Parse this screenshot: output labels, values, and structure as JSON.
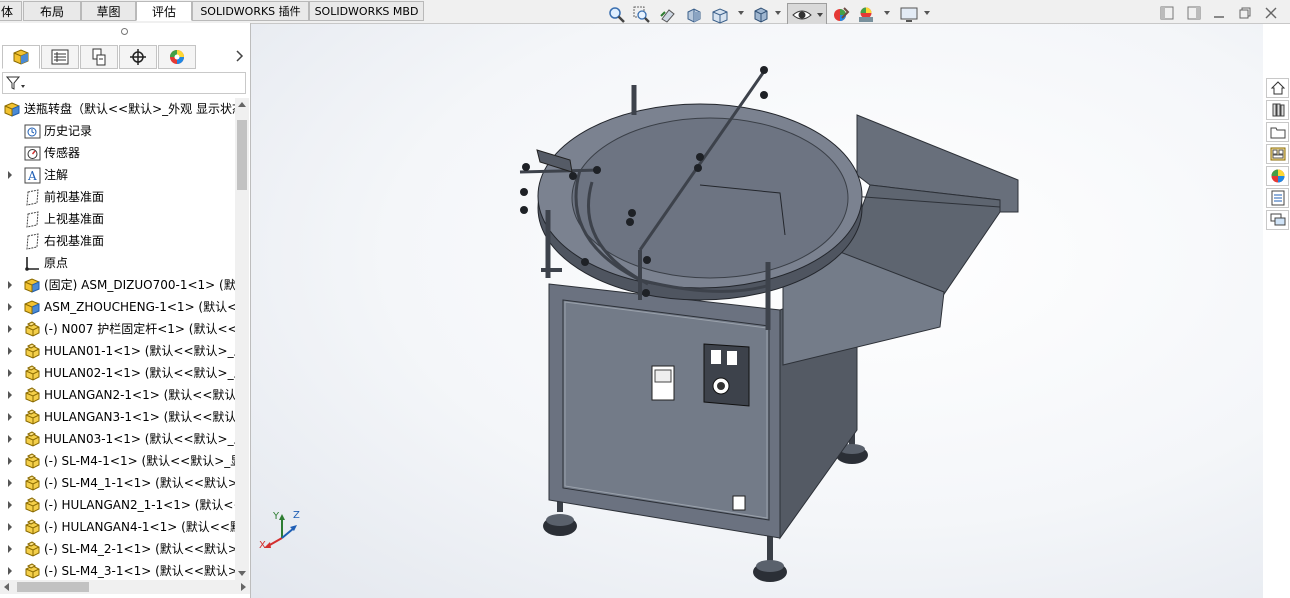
{
  "tabs": [
    {
      "label": "体"
    },
    {
      "label": "布局"
    },
    {
      "label": "草图"
    },
    {
      "label": "评估"
    },
    {
      "label": "SOLIDWORKS 插件"
    },
    {
      "label": "SOLIDWORKS MBD"
    }
  ],
  "active_tab": "评估",
  "view_toolbar": [
    "zoom-to-fit-icon",
    "zoom-to-area-icon",
    "previous-view-icon",
    "section-view-icon",
    "view-orientation-icon",
    "display-style-icon",
    "hide-show-items-icon",
    "edit-appearance-icon",
    "apply-scene-icon",
    "view-settings-icon"
  ],
  "feature_manager": {
    "tabs": [
      "featuremanager-tree-icon",
      "property-manager-icon",
      "configuration-manager-icon",
      "dimxpert-manager-icon",
      "display-manager-icon"
    ],
    "tree": [
      {
        "label": "送瓶转盘（默认<<默认>_外观 显示状态",
        "icon": "assembly",
        "expandable": false,
        "indent": 0
      },
      {
        "label": "历史记录",
        "icon": "history",
        "expandable": false,
        "indent": 1
      },
      {
        "label": "传感器",
        "icon": "sensor",
        "expandable": false,
        "indent": 1
      },
      {
        "label": "注解",
        "icon": "annotation",
        "expandable": true,
        "indent": 1
      },
      {
        "label": "前视基准面",
        "icon": "plane",
        "expandable": false,
        "indent": 1
      },
      {
        "label": "上视基准面",
        "icon": "plane",
        "expandable": false,
        "indent": 1
      },
      {
        "label": "右视基准面",
        "icon": "plane",
        "expandable": false,
        "indent": 1
      },
      {
        "label": "原点",
        "icon": "origin",
        "expandable": false,
        "indent": 1
      },
      {
        "label": "(固定) ASM_DIZUO700-1<1> (默认",
        "icon": "subassembly",
        "expandable": true,
        "indent": 1
      },
      {
        "label": "ASM_ZHOUCHENG-1<1> (默认<",
        "icon": "subassembly",
        "expandable": true,
        "indent": 1
      },
      {
        "label": "(-) N007 护栏固定杆<1> (默认<<",
        "icon": "part",
        "expandable": true,
        "indent": 1
      },
      {
        "label": "HULAN01-1<1> (默认<<默认>_显",
        "icon": "part",
        "expandable": true,
        "indent": 1
      },
      {
        "label": "HULAN02-1<1> (默认<<默认>_显",
        "icon": "part",
        "expandable": true,
        "indent": 1
      },
      {
        "label": "HULANGAN2-1<1> (默认<<默认",
        "icon": "part",
        "expandable": true,
        "indent": 1
      },
      {
        "label": "HULANGAN3-1<1> (默认<<默认",
        "icon": "part",
        "expandable": true,
        "indent": 1
      },
      {
        "label": "HULAN03-1<1> (默认<<默认>_显",
        "icon": "part",
        "expandable": true,
        "indent": 1
      },
      {
        "label": "(-) SL-M4-1<1> (默认<<默认>_显",
        "icon": "part",
        "expandable": true,
        "indent": 1
      },
      {
        "label": "(-) SL-M4_1-1<1> (默认<<默认>",
        "icon": "part",
        "expandable": true,
        "indent": 1
      },
      {
        "label": "(-) HULANGAN2_1-1<1> (默认<<",
        "icon": "part",
        "expandable": true,
        "indent": 1
      },
      {
        "label": "(-) HULANGAN4-1<1> (默认<<默",
        "icon": "part",
        "expandable": true,
        "indent": 1
      },
      {
        "label": "(-) SL-M4_2-1<1> (默认<<默认>",
        "icon": "part",
        "expandable": true,
        "indent": 1
      },
      {
        "label": "(-) SL-M4_3-1<1> (默认<<默认>",
        "icon": "part",
        "expandable": true,
        "indent": 1
      }
    ]
  },
  "triad": {
    "x": "X",
    "y": "Y",
    "z": "Z"
  },
  "task_pane": [
    "solidworks-resources-icon",
    "design-library-icon",
    "file-explorer-icon",
    "view-palette-icon",
    "appearances-icon",
    "custom-properties-icon",
    "forum-icon"
  ],
  "colors": {
    "machine_body": "#5d6470",
    "machine_dark": "#3d424b",
    "accent_blue": "#1f5fb5",
    "part_yellow": "#e8b632"
  }
}
